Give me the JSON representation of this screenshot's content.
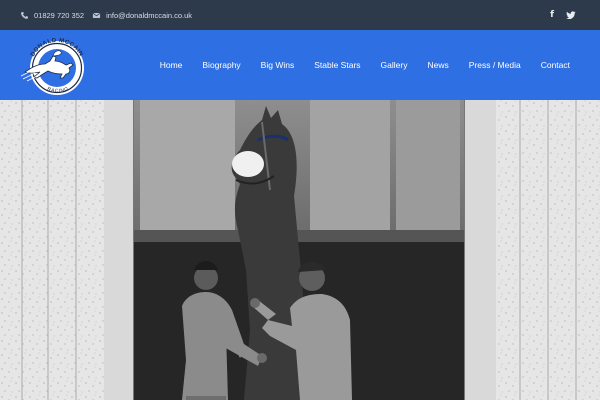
{
  "topbar": {
    "phone": "01829 720 352",
    "email": "info@donaldmccain.co.uk",
    "phone_icon": "phone-icon",
    "email_icon": "envelope-icon",
    "social": [
      {
        "icon": "facebook-icon",
        "glyph": "f"
      },
      {
        "icon": "twitter-icon",
        "glyph": ""
      }
    ]
  },
  "brand": {
    "logo_text_top": "DONALD MCCAIN",
    "logo_text_bottom": "RACING",
    "logo_icon": "horse-jumper-icon"
  },
  "nav": {
    "items": [
      "Home",
      "Biography",
      "Big Wins",
      "Stable Stars",
      "Gallery",
      "News",
      "Press / Media",
      "Contact"
    ]
  },
  "colors": {
    "topbar_bg": "#2c3a4c",
    "header_bg": "#2f6fe4",
    "nav_text": "#ffffff"
  },
  "hero": {
    "image": "black-and-white photo of two stable hands with a horse in a stable doorway"
  }
}
